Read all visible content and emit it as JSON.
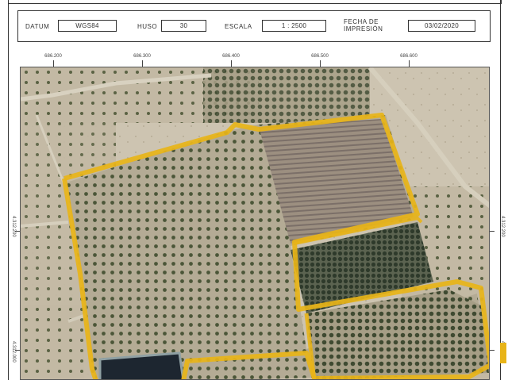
{
  "header": {
    "datum_label": "DATUM",
    "datum_value": "WGS84",
    "huso_label": "HUSO",
    "huso_value": "30",
    "escala_label": "ESCALA",
    "escala_value": "1 : 2500",
    "fecha_label_line1": "FECHA DE",
    "fecha_label_line2": "IMPRESIÓN",
    "fecha_value": "03/02/2020"
  },
  "coordinates": {
    "x_ticks": [
      "686.200",
      "686.300",
      "686.400",
      "686.500",
      "686.600"
    ],
    "y_ticks": [
      "4.312.200",
      "4.312.000"
    ]
  },
  "map": {
    "imagery": "aerial-orthophoto",
    "parcel_outline_color": "#e8b418",
    "soil_color": "#b9ae99",
    "water_color": "#1d2630"
  }
}
